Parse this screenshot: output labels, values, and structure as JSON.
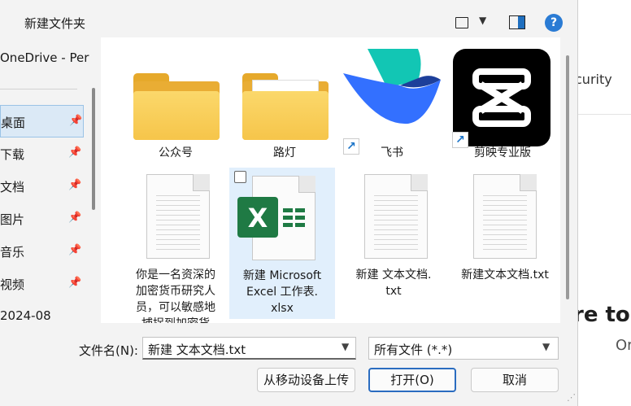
{
  "toolbar": {
    "new_folder": "新建文件夹",
    "help": "?"
  },
  "sidebar": {
    "onedrive": "OneDrive - Per",
    "items": [
      {
        "label": "桌面",
        "pinned": true
      },
      {
        "label": "下载",
        "pinned": true
      },
      {
        "label": "文档",
        "pinned": true
      },
      {
        "label": "图片",
        "pinned": true
      },
      {
        "label": "音乐",
        "pinned": true
      },
      {
        "label": "视频",
        "pinned": true
      },
      {
        "label": "2024-08",
        "pinned": false
      }
    ]
  },
  "files": [
    {
      "name": "公众号",
      "type": "folder"
    },
    {
      "name": "路灯",
      "type": "folder"
    },
    {
      "name": "飞书",
      "type": "shortcut"
    },
    {
      "name": "剪映专业版",
      "type": "shortcut"
    },
    {
      "name": "你是一名资深的加密货币研究人员，可以敏感地捕捉到加密货",
      "lines": [
        "你是一名资深的",
        "加密货币研究人",
        "员，可以敏感地",
        "捕捉到加密货"
      ],
      "type": "txt"
    },
    {
      "name": "新建 Microsoft Excel 工作表.xlsx",
      "lines": [
        "新建 Microsoft",
        "Excel 工作表.",
        "xlsx"
      ],
      "type": "xlsx"
    },
    {
      "name": "新建 文本文档.txt",
      "lines": [
        "新建 文本文档.",
        "txt"
      ],
      "type": "txt"
    },
    {
      "name": "新建文本文档.txt",
      "type": "txt"
    }
  ],
  "bottom": {
    "filename_label": "文件名(N):",
    "filename_value": "新建 文本文档.txt",
    "filetype": "所有文件 (*.*)",
    "upload_button": "从移动设备上传",
    "open_button": "打开(O)",
    "cancel_button": "取消"
  },
  "background_window": {
    "security_text": "curity",
    "welcome_text": "re to",
    "on_text": "Or"
  },
  "colors": {
    "accent": "#2a6cc0",
    "selection": "#dbe9f6",
    "excel_green": "#1f7a44",
    "capcut_bg": "#000000"
  }
}
